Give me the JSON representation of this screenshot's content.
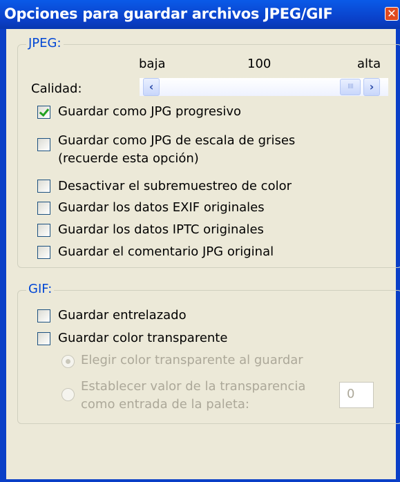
{
  "window": {
    "title": "Opciones para guardar archivos JPEG/GIF",
    "close_glyph": "✕"
  },
  "jpeg": {
    "legend": "JPEG:",
    "quality": {
      "label": "Calidad:",
      "low_label": "baja",
      "value_label": "100",
      "high_label": "alta",
      "value": 100
    },
    "options": [
      {
        "label": "Guardar como JPG progresivo",
        "checked": true
      },
      {
        "label": "Guardar como JPG de escala de grises",
        "label2": "(recuerde esta opción)",
        "checked": false
      },
      {
        "label": "Desactivar el subremuestreo de color",
        "checked": false
      },
      {
        "label": "Guardar los datos EXIF originales",
        "checked": false
      },
      {
        "label": "Guardar los datos IPTC originales",
        "checked": false
      },
      {
        "label": "Guardar el comentario JPG original",
        "checked": false
      }
    ]
  },
  "gif": {
    "legend": "GIF:",
    "options": [
      {
        "label": "Guardar entrelazado",
        "checked": false
      },
      {
        "label": "Guardar color transparente",
        "checked": false
      }
    ],
    "radios": [
      {
        "label": "Elegir color transparente al guardar",
        "selected": true
      },
      {
        "label": "Establecer valor de la transparencia",
        "label2": "como entrada de la paleta:",
        "selected": false
      }
    ],
    "palette_entry_value": "0"
  },
  "colors": {
    "titlebar": "#0a3fc7",
    "legend": "#0046d5",
    "face": "#ece9d8"
  }
}
